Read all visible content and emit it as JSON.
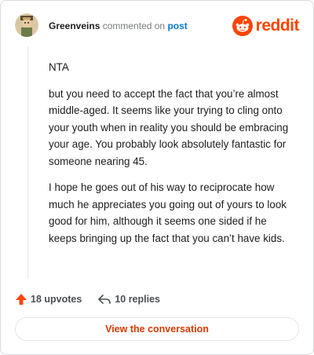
{
  "comment": {
    "username": "Greenveins",
    "action_text": "commented on",
    "post_link": "post",
    "paragraphs": [
      "NTA",
      "but you need to accept the fact that you’re almost middle-aged. It seems like your trying to cling onto your youth when in reality you should be embracing your age. You probably look absolutely fantastic for someone nearing 45.",
      "I hope he goes out of his way to reciprocate how much he appreciates you going out of yours to look good for him, although it seems one sided if he keeps bringing up the fact that you can’t have kids."
    ],
    "upvotes": "18 upvotes",
    "replies": "10 replies"
  },
  "brand": {
    "name": "reddit",
    "icon": "reddit-alien-icon",
    "color": "#ff4500"
  },
  "actions": {
    "view_conversation": "View the conversation"
  },
  "colors": {
    "upvote": "#ff4500",
    "link": "#0079d3",
    "button_text": "#d93a00"
  }
}
